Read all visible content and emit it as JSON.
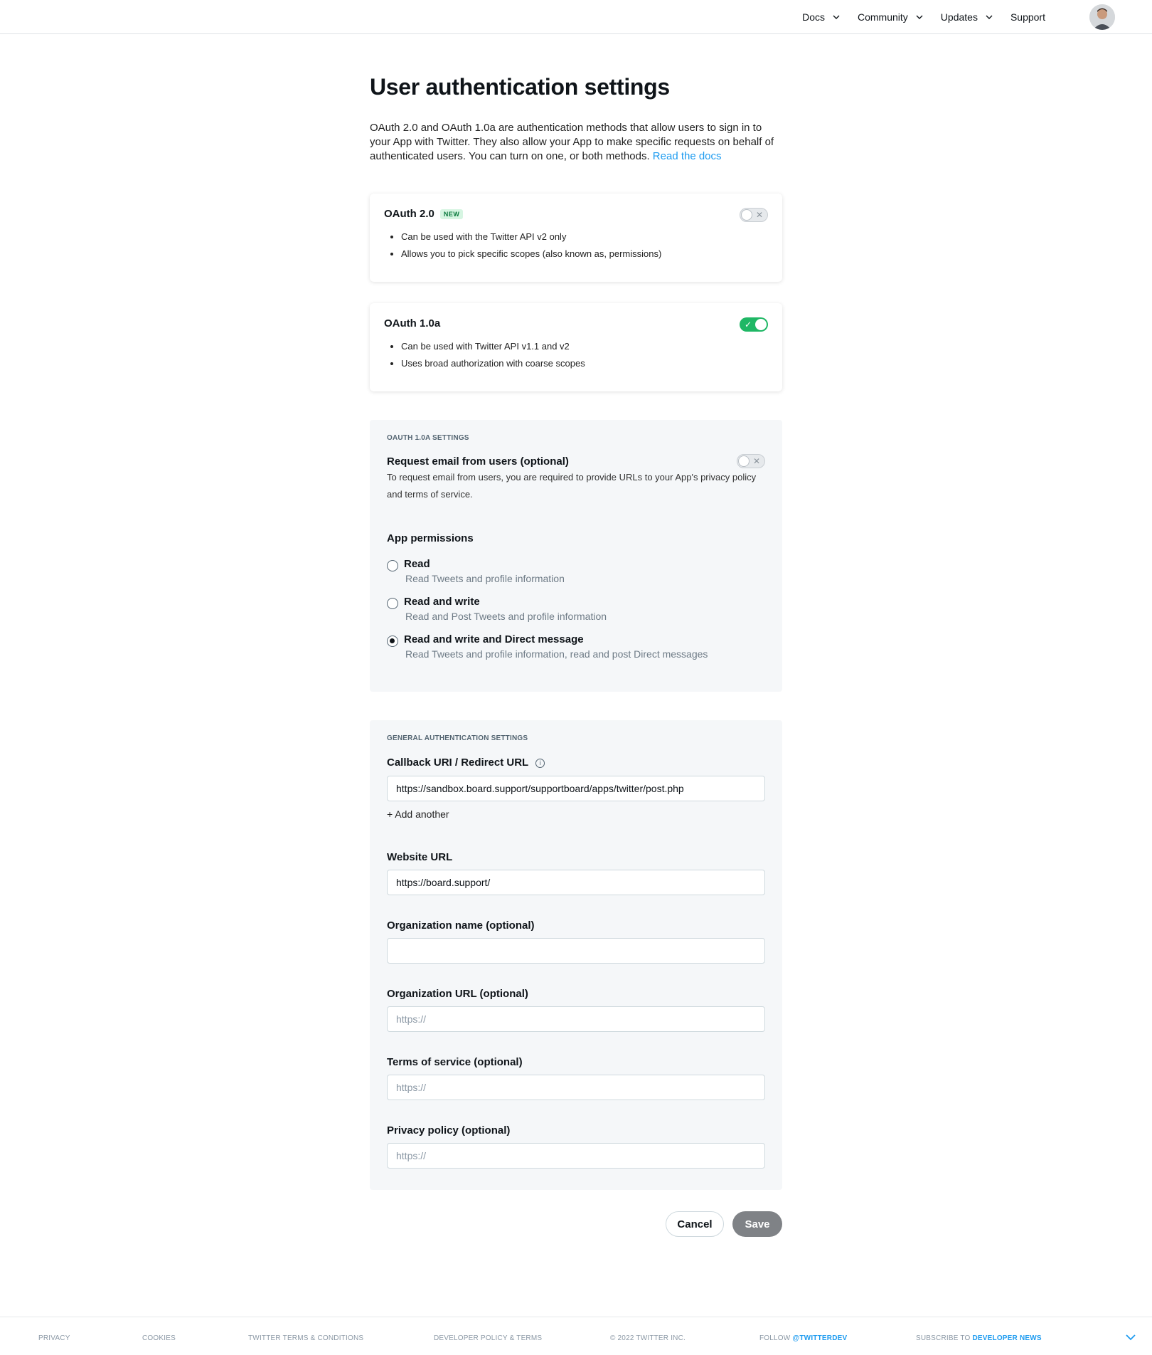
{
  "nav": {
    "items": [
      {
        "label": "Docs",
        "has_dropdown": true
      },
      {
        "label": "Community",
        "has_dropdown": true
      },
      {
        "label": "Updates",
        "has_dropdown": true
      },
      {
        "label": "Support",
        "has_dropdown": false
      }
    ],
    "avatar_icon": "user-avatar-icon"
  },
  "page": {
    "title": "User authentication settings",
    "intro_text": "OAuth 2.0 and OAuth 1.0a are authentication methods that allow users to sign in to your App with Twitter. They also allow your App to make specific requests on behalf of authenticated users. You can turn on one, or both methods.",
    "intro_link": "Read the docs"
  },
  "oauth2": {
    "title": "OAuth 2.0",
    "badge": "NEW",
    "enabled": false,
    "bullets": [
      "Can be used with the Twitter API v2 only",
      "Allows you to pick specific scopes (also known as, permissions)"
    ]
  },
  "oauth1": {
    "title": "OAuth 1.0a",
    "enabled": true,
    "bullets": [
      "Can be used with Twitter API v1.1 and v2",
      "Uses broad authorization with coarse scopes"
    ]
  },
  "oauth1_settings": {
    "section_label": "OAUTH 1.0A SETTINGS",
    "request_email_label": "Request email from users (optional)",
    "request_email_enabled": false,
    "request_email_help": "To request email from users, you are required to provide URLs to your App's privacy policy and terms of service.",
    "permissions_label": "App permissions",
    "permissions": [
      {
        "title": "Read",
        "desc": "Read Tweets and profile information",
        "checked": false
      },
      {
        "title": "Read and write",
        "desc": "Read and Post Tweets and profile information",
        "checked": false
      },
      {
        "title": "Read and write and Direct message",
        "desc": "Read Tweets and profile information, read and post Direct messages",
        "checked": true
      }
    ]
  },
  "general_settings": {
    "section_label": "GENERAL AUTHENTICATION SETTINGS",
    "callback_label": "Callback URI / Redirect URL",
    "callback_value": "https://sandbox.board.support/supportboard/apps/twitter/post.php",
    "add_another": "+ Add another",
    "website_label": "Website URL",
    "website_value": "https://board.support/",
    "org_name_label": "Organization name (optional)",
    "org_name_value": "",
    "org_url_label": "Organization URL (optional)",
    "org_url_placeholder": "https://",
    "tos_label": "Terms of service (optional)",
    "tos_placeholder": "https://",
    "privacy_label": "Privacy policy (optional)",
    "privacy_placeholder": "https://"
  },
  "actions": {
    "cancel": "Cancel",
    "save": "Save"
  },
  "footer": {
    "privacy": "PRIVACY",
    "cookies": "COOKIES",
    "terms": "TWITTER TERMS & CONDITIONS",
    "dev_policy": "DEVELOPER POLICY & TERMS",
    "copyright": "© 2022 TWITTER INC.",
    "follow_prefix": "FOLLOW",
    "follow_handle": "@TWITTERDEV",
    "subscribe_prefix": "SUBSCRIBE TO",
    "subscribe_target": "DEVELOPER NEWS"
  },
  "colors": {
    "accent": "#1d9bf0",
    "toggle_on": "#1fb765",
    "save_button": "#7f8286",
    "panel_bg": "#f5f7f9"
  }
}
